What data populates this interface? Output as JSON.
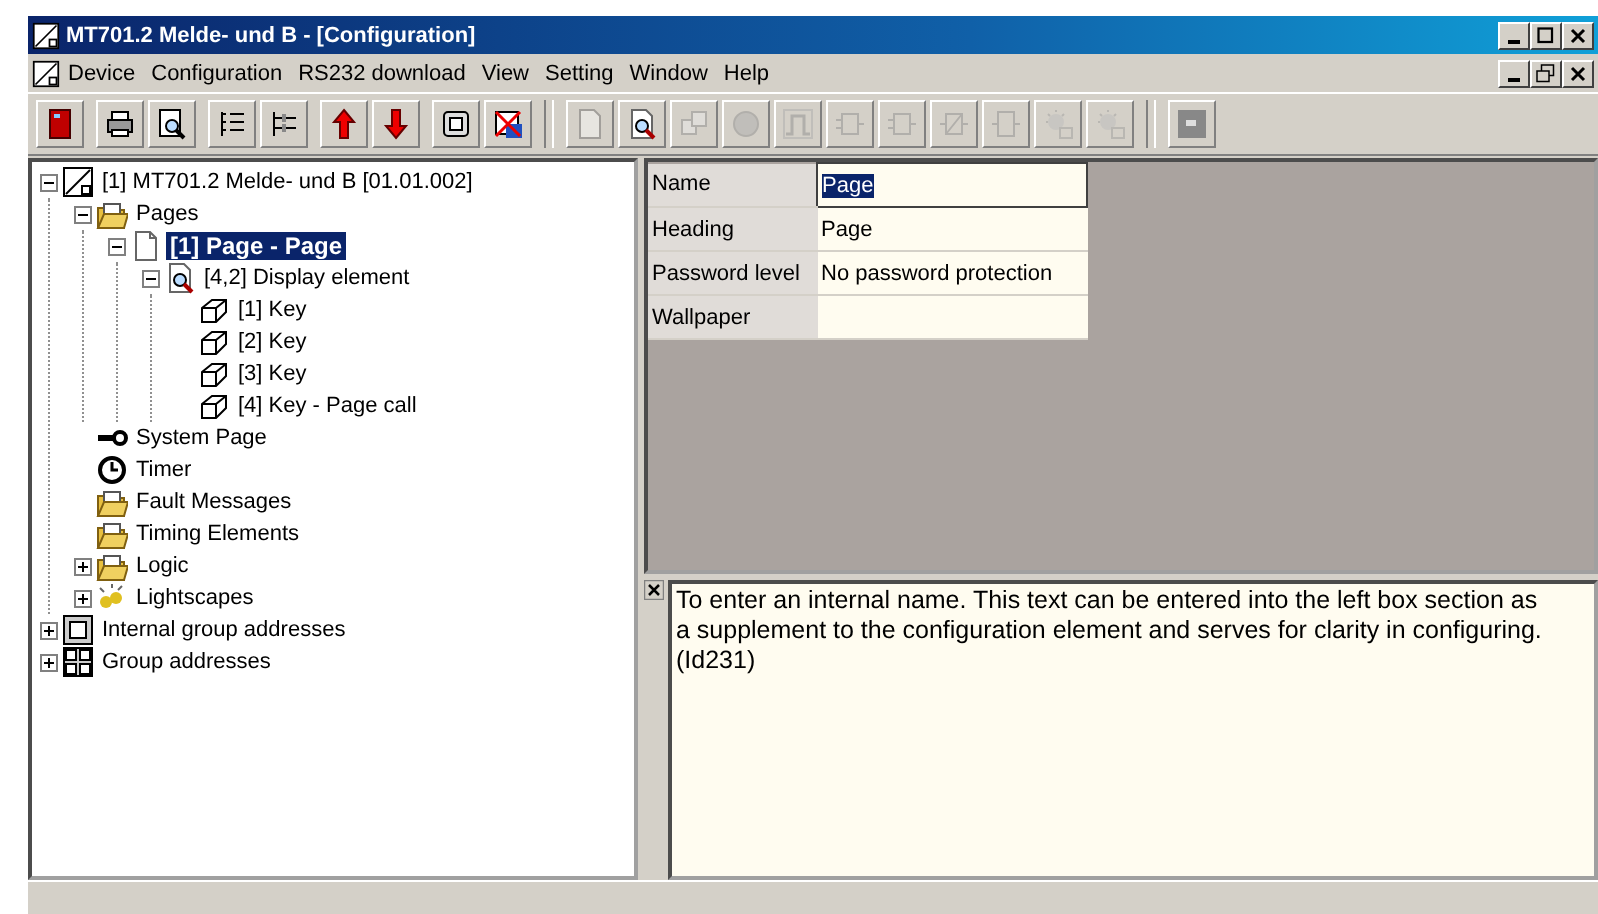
{
  "window": {
    "title": "MT701.2 Melde- und B  - [Configuration]"
  },
  "menu": [
    "Device",
    "Configuration",
    "RS232 download",
    "View",
    "Setting",
    "Window",
    "Help"
  ],
  "toolbar": [
    [
      {
        "kind": "door",
        "disabled": false
      }
    ],
    [
      {
        "kind": "printer",
        "disabled": false
      },
      {
        "kind": "preview",
        "disabled": false
      }
    ],
    [
      {
        "kind": "list",
        "disabled": false
      },
      {
        "kind": "tree",
        "disabled": false
      }
    ],
    [
      {
        "kind": "up",
        "disabled": false
      },
      {
        "kind": "down",
        "disabled": false
      }
    ],
    [
      {
        "kind": "screen",
        "disabled": false
      },
      {
        "kind": "nodisplay",
        "disabled": false
      }
    ],
    [
      {
        "kind": "page",
        "disabled": true
      },
      {
        "kind": "display",
        "disabled": false
      },
      {
        "kind": "keys",
        "disabled": true
      },
      {
        "kind": "circle",
        "disabled": true
      },
      {
        "kind": "pulse",
        "disabled": true
      },
      {
        "kind": "gate",
        "disabled": true
      },
      {
        "kind": "gate",
        "disabled": true
      },
      {
        "kind": "logic",
        "disabled": true
      },
      {
        "kind": "block",
        "disabled": true
      },
      {
        "kind": "bulb",
        "disabled": true
      },
      {
        "kind": "bulb",
        "disabled": true
      }
    ],
    [
      {
        "kind": "window",
        "disabled": false
      }
    ]
  ],
  "tree": [
    {
      "label": "[1] MT701.2 Melde- und B [01.01.002]",
      "kind": "device",
      "expanded": true,
      "selected": false,
      "children": [
        {
          "label": "Pages",
          "kind": "folder",
          "expanded": true,
          "selected": false,
          "children": [
            {
              "label": "[1] Page - Page",
              "kind": "page",
              "expanded": true,
              "selected": true,
              "children": [
                {
                  "label": "[4,2] Display element",
                  "kind": "display",
                  "expanded": true,
                  "selected": false,
                  "children": [
                    {
                      "label": "[1] Key",
                      "kind": "key",
                      "selected": false
                    },
                    {
                      "label": "[2] Key",
                      "kind": "key",
                      "selected": false
                    },
                    {
                      "label": "[3] Key",
                      "kind": "key",
                      "selected": false
                    },
                    {
                      "label": "[4] Key - Page call",
                      "kind": "key",
                      "selected": false
                    }
                  ]
                }
              ]
            }
          ]
        },
        {
          "label": "System Page",
          "kind": "syskey",
          "selected": false
        },
        {
          "label": "Timer",
          "kind": "clock",
          "selected": false
        },
        {
          "label": "Fault Messages",
          "kind": "folder",
          "selected": false
        },
        {
          "label": "Timing Elements",
          "kind": "folder",
          "selected": false
        },
        {
          "label": "Logic",
          "kind": "folder",
          "expanded": false,
          "selected": false
        },
        {
          "label": "Lightscapes",
          "kind": "lights",
          "expanded": false,
          "selected": false
        }
      ]
    },
    {
      "label": "Internal group addresses",
      "kind": "group",
      "expanded": false,
      "selected": false
    },
    {
      "label": "Group addresses",
      "kind": "groups",
      "expanded": false,
      "selected": false
    }
  ],
  "properties": [
    {
      "name": "Name",
      "value": "Page",
      "selected": true
    },
    {
      "name": "Heading",
      "value": "Page",
      "selected": false
    },
    {
      "name": "Password level",
      "value": "No password protection",
      "selected": false
    },
    {
      "name": "Wallpaper",
      "selected": false
    }
  ],
  "help": {
    "text": "To enter an internal name. This text can be entered into the left box section as a supplement to the configuration element and serves for clarity in configuring. (Id231)"
  }
}
